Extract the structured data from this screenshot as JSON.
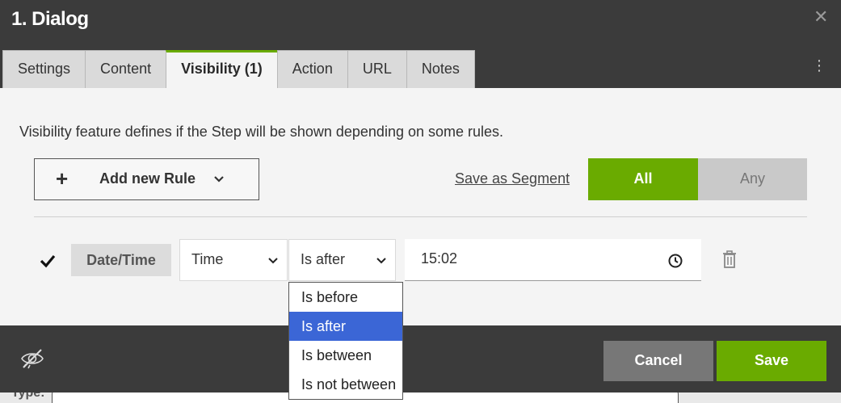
{
  "dialog": {
    "title": "1. Dialog",
    "close_icon": "close-icon",
    "menu_icon": "kebab-menu-icon"
  },
  "tabs": [
    {
      "label": "Settings",
      "active": false
    },
    {
      "label": "Content",
      "active": false
    },
    {
      "label": "Visibility (1)",
      "active": true
    },
    {
      "label": "Action",
      "active": false
    },
    {
      "label": "URL",
      "active": false
    },
    {
      "label": "Notes",
      "active": false
    }
  ],
  "visibility": {
    "description": "Visibility feature defines if the Step will be shown depending on some rules.",
    "add_rule_label": "Add new Rule",
    "save_segment_label": "Save as Segment",
    "match_all_label": "All",
    "match_any_label": "Any",
    "match_selected": "All"
  },
  "rule": {
    "enabled": true,
    "type_chip": "Date/Time",
    "field_value": "Time",
    "operator_value": "Is after",
    "time_value": "15:02"
  },
  "operator_options": [
    {
      "label": "Is before",
      "selected": false
    },
    {
      "label": "Is after",
      "selected": true
    },
    {
      "label": "Is between",
      "selected": false
    },
    {
      "label": "Is not between",
      "selected": false
    }
  ],
  "footer": {
    "cancel_label": "Cancel",
    "save_label": "Save",
    "visibility_icon": "eye-off-icon"
  },
  "background": {
    "partial_label": "Type:"
  },
  "colors": {
    "header_bg": "#3b3b3b",
    "accent_green": "#6aab00",
    "option_highlight": "#3b66d6",
    "cancel_bg": "#777777"
  }
}
